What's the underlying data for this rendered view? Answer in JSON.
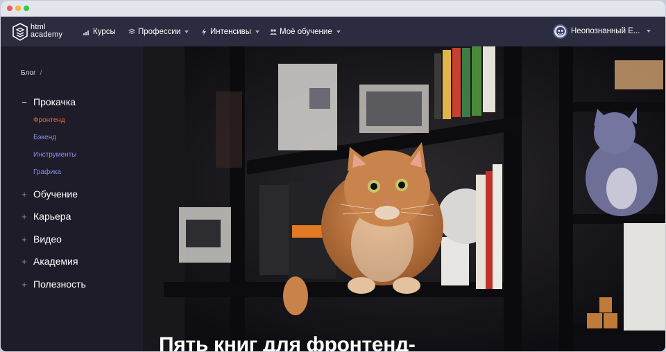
{
  "nav": {
    "logo_line1": "html",
    "logo_line2": "academy",
    "items": [
      {
        "label": "Курсы",
        "icon": "courses-icon",
        "has_caret": false
      },
      {
        "label": "Профессии",
        "icon": "professions-icon",
        "has_caret": true
      },
      {
        "label": "Интенсивы",
        "icon": "lightning-icon",
        "has_caret": true
      },
      {
        "label": "Моё обучение",
        "icon": "people-icon",
        "has_caret": true
      }
    ],
    "user_name": "Неопознанный Е..."
  },
  "sidebar": {
    "breadcrumb": "Блог",
    "breadcrumb_sep": "/",
    "sections": [
      {
        "label": "Прокачка",
        "state": "open",
        "marker": "−"
      },
      {
        "label": "Обучение",
        "state": "closed",
        "marker": "+"
      },
      {
        "label": "Карьера",
        "state": "closed",
        "marker": "+"
      },
      {
        "label": "Видео",
        "state": "closed",
        "marker": "+"
      },
      {
        "label": "Академия",
        "state": "closed",
        "marker": "+"
      },
      {
        "label": "Полезность",
        "state": "closed",
        "marker": "+"
      }
    ],
    "subitems": [
      {
        "label": "Фронтенд",
        "active": true
      },
      {
        "label": "Бэкенд",
        "active": false
      },
      {
        "label": "Инструменты",
        "active": false
      },
      {
        "label": "Графика",
        "active": false
      }
    ]
  },
  "hero": {
    "title": "Пять книг для фронтенд-",
    "image": "cat-on-bookshelf-photo"
  },
  "colors": {
    "nav_bg": "#2c2c40",
    "sidebar_bg": "#1d1c28",
    "active_link": "#f0663a",
    "sub_link": "#8a8ef0"
  }
}
